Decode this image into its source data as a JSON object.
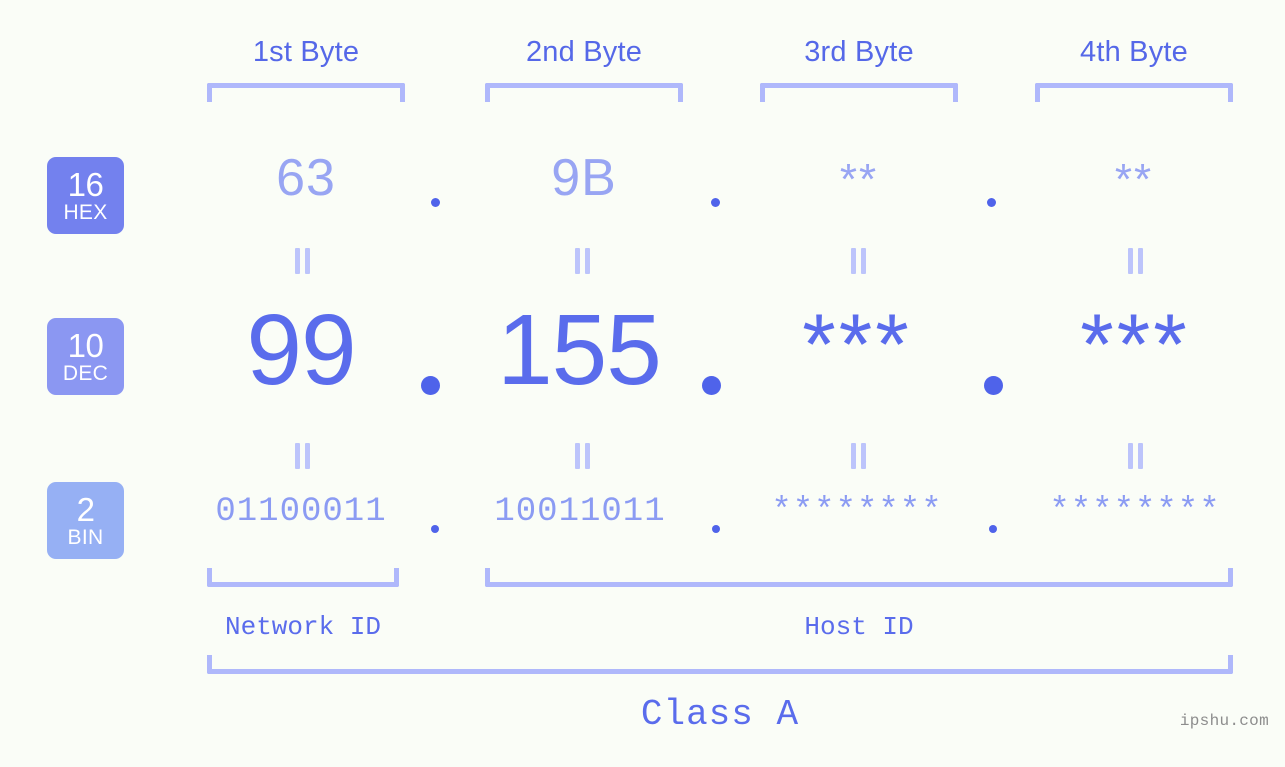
{
  "meta": {
    "background_color": "#fafdf7",
    "accent_light": "#afb8fb",
    "accent_mid": "#8b9bf3",
    "accent_strong": "#5a6cec",
    "watermark": "ipshu.com"
  },
  "byte_headers": [
    {
      "label": "1st Byte"
    },
    {
      "label": "2nd Byte"
    },
    {
      "label": "3rd Byte"
    },
    {
      "label": "4th Byte"
    }
  ],
  "bases": [
    {
      "number": "16",
      "name": "HEX",
      "color": "#7381ee"
    },
    {
      "number": "10",
      "name": "DEC",
      "color": "#8b97f2"
    },
    {
      "number": "2",
      "name": "BIN",
      "color": "#96b0f4"
    }
  ],
  "rows": {
    "hex": {
      "values": [
        "63",
        "9B",
        "**",
        "**"
      ],
      "separator": "."
    },
    "dec": {
      "values": [
        "99",
        "155",
        "***",
        "***"
      ],
      "separator": "."
    },
    "bin": {
      "values": [
        "01100011",
        "10011011",
        "********",
        "********"
      ],
      "separator": "."
    }
  },
  "equals_symbol": "=",
  "segments": {
    "network_id": "Network ID",
    "host_id": "Host ID"
  },
  "class_label": "Class A"
}
